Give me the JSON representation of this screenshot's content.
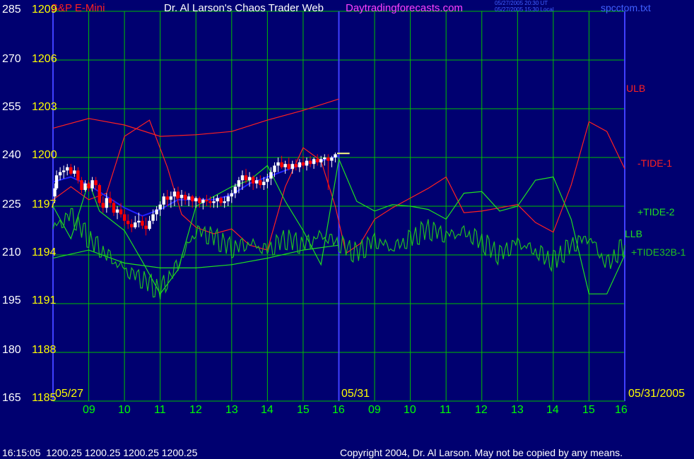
{
  "header": {
    "instrument": "S&P E-Mini",
    "title": "Dr. Al Larson's Chaos Trader Web",
    "site": "Daytradingforecasts.com",
    "time_ut": "05/27/2005 20:30 UT",
    "time_local": "05/27/2005 15:30 Local",
    "file": "spcctom.txt"
  },
  "footer": {
    "quote": "16:15:05  1200.25 1200.25 1200.25 1200.25",
    "copyright": "Copyright 2004, Dr. Al Larson. May not be copied by any means."
  },
  "colors": {
    "background": "#000070",
    "grid": "#00c000",
    "divider": "#4040ff",
    "price_up": "#ffffff",
    "price_down": "#ff0000",
    "price_flat": "#ffff80",
    "avg": "#2020ff",
    "ulb": "#ff2020",
    "tide1": "#ff2020",
    "tide2": "#20e020",
    "llb": "#20e020",
    "tide32b": "#20c020"
  },
  "chart_data": {
    "type": "line",
    "left_axis_labels": [
      "285",
      "270",
      "255",
      "240",
      "225",
      "210",
      "195",
      "180",
      "165"
    ],
    "price_axis_labels": [
      "1209",
      "1206",
      "1203",
      "1200",
      "1197",
      "1194",
      "1191",
      "1188",
      "1185"
    ],
    "ylim_price": [
      1185,
      1209
    ],
    "ylim_left": [
      165,
      285
    ],
    "xlim_hours": [
      0,
      16
    ],
    "x_tick_labels": [
      "09",
      "10",
      "11",
      "12",
      "13",
      "14",
      "15",
      "16",
      "09",
      "10",
      "11",
      "12",
      "13",
      "14",
      "15",
      "16"
    ],
    "x_tick_hours": [
      1,
      2,
      3,
      4,
      5,
      6,
      7,
      8,
      9,
      10,
      11,
      12,
      13,
      14,
      15,
      16
    ],
    "date_labels": [
      "05/27",
      "05/31",
      "05/31/2005"
    ],
    "last_price": 1200.25,
    "price_bars": [
      [
        0.05,
        1197.2,
        1198.4,
        1197.6,
        1198.1
      ],
      [
        0.1,
        1198.0,
        1199.2,
        1198.1,
        1198.9
      ],
      [
        0.2,
        1198.6,
        1199.4,
        1198.9,
        1199.1
      ],
      [
        0.3,
        1198.7,
        1199.5,
        1199.1,
        1199.2
      ],
      [
        0.4,
        1198.9,
        1199.6,
        1199.2,
        1199.4
      ],
      [
        0.5,
        1198.9,
        1199.6,
        1199.4,
        1199.0
      ],
      [
        0.6,
        1198.8,
        1199.5,
        1199.0,
        1199.2
      ],
      [
        0.7,
        1198.4,
        1199.4,
        1199.2,
        1198.6
      ],
      [
        0.8,
        1197.8,
        1198.8,
        1198.6,
        1198.0
      ],
      [
        0.9,
        1197.9,
        1198.6,
        1198.0,
        1198.4
      ],
      [
        1.0,
        1197.9,
        1198.6,
        1198.4,
        1198.1
      ],
      [
        1.1,
        1197.9,
        1198.8,
        1198.1,
        1198.6
      ],
      [
        1.2,
        1198.0,
        1198.8,
        1198.6,
        1198.3
      ],
      [
        1.3,
        1197.0,
        1198.4,
        1198.3,
        1197.2
      ],
      [
        1.4,
        1196.6,
        1197.6,
        1197.2,
        1196.9
      ],
      [
        1.5,
        1196.6,
        1197.8,
        1196.9,
        1197.5
      ],
      [
        1.6,
        1196.9,
        1197.9,
        1197.5,
        1197.2
      ],
      [
        1.7,
        1196.4,
        1197.4,
        1197.2,
        1196.6
      ],
      [
        1.8,
        1196.2,
        1197.0,
        1196.6,
        1196.8
      ],
      [
        1.9,
        1196.3,
        1197.2,
        1196.8,
        1196.5
      ],
      [
        2.0,
        1195.8,
        1196.8,
        1196.5,
        1196.1
      ],
      [
        2.1,
        1195.6,
        1196.5,
        1196.1,
        1195.9
      ],
      [
        2.2,
        1195.4,
        1196.2,
        1195.9,
        1195.7
      ],
      [
        2.3,
        1195.6,
        1196.4,
        1195.7,
        1196.0
      ],
      [
        2.4,
        1195.7,
        1196.6,
        1196.0,
        1196.1
      ],
      [
        2.5,
        1195.6,
        1196.4,
        1196.1,
        1195.8
      ],
      [
        2.6,
        1195.2,
        1196.3,
        1195.8,
        1195.6
      ],
      [
        2.7,
        1195.5,
        1196.4,
        1195.6,
        1196.1
      ],
      [
        2.8,
        1195.9,
        1196.8,
        1196.1,
        1196.5
      ],
      [
        2.9,
        1196.1,
        1197.0,
        1196.5,
        1196.8
      ],
      [
        3.0,
        1196.4,
        1197.3,
        1196.8,
        1197.1
      ],
      [
        3.1,
        1196.8,
        1197.8,
        1197.1,
        1197.6
      ],
      [
        3.2,
        1197.0,
        1198.0,
        1197.6,
        1197.4
      ],
      [
        3.3,
        1196.9,
        1197.9,
        1197.4,
        1197.6
      ],
      [
        3.4,
        1197.0,
        1198.1,
        1197.6,
        1197.9
      ],
      [
        3.5,
        1197.2,
        1198.2,
        1197.9,
        1197.5
      ],
      [
        3.6,
        1197.0,
        1198.0,
        1197.5,
        1197.7
      ],
      [
        3.7,
        1197.1,
        1197.9,
        1197.7,
        1197.4
      ],
      [
        3.8,
        1197.0,
        1197.8,
        1197.4,
        1197.6
      ],
      [
        3.9,
        1196.9,
        1197.7,
        1197.6,
        1197.3
      ],
      [
        4.0,
        1196.9,
        1197.6,
        1197.3,
        1197.5
      ],
      [
        4.1,
        1196.9,
        1197.6,
        1197.5,
        1197.2
      ],
      [
        4.2,
        1196.8,
        1197.5,
        1197.2,
        1197.4
      ],
      [
        4.3,
        1197.0,
        1197.7,
        1197.4,
        1197.3
      ],
      [
        4.4,
        1196.9,
        1197.6,
        1197.3,
        1197.2
      ],
      [
        4.5,
        1196.9,
        1197.6,
        1197.2,
        1197.3
      ],
      [
        4.6,
        1196.9,
        1197.7,
        1197.3,
        1197.5
      ],
      [
        4.7,
        1197.0,
        1197.6,
        1197.5,
        1197.2
      ],
      [
        4.8,
        1196.9,
        1197.6,
        1197.2,
        1197.3
      ],
      [
        4.9,
        1197.0,
        1197.8,
        1197.3,
        1197.6
      ],
      [
        5.0,
        1197.2,
        1198.0,
        1197.6,
        1197.8
      ],
      [
        5.1,
        1197.5,
        1198.4,
        1197.8,
        1198.2
      ],
      [
        5.2,
        1197.8,
        1198.8,
        1198.2,
        1198.6
      ],
      [
        5.3,
        1198.0,
        1199.2,
        1198.6,
        1198.9
      ],
      [
        5.4,
        1198.4,
        1199.3,
        1198.9,
        1198.6
      ],
      [
        5.5,
        1198.2,
        1199.1,
        1198.6,
        1198.8
      ],
      [
        5.6,
        1198.0,
        1198.9,
        1198.8,
        1198.4
      ],
      [
        5.7,
        1198.1,
        1198.8,
        1198.4,
        1198.6
      ],
      [
        5.8,
        1198.1,
        1198.9,
        1198.6,
        1198.3
      ],
      [
        5.9,
        1198.0,
        1198.8,
        1198.3,
        1198.5
      ],
      [
        6.0,
        1198.1,
        1199.0,
        1198.5,
        1198.7
      ],
      [
        6.1,
        1198.3,
        1199.4,
        1198.7,
        1199.1
      ],
      [
        6.2,
        1198.8,
        1199.7,
        1199.1,
        1199.5
      ],
      [
        6.3,
        1199.1,
        1200.0,
        1199.5,
        1199.7
      ],
      [
        6.4,
        1199.3,
        1200.1,
        1199.7,
        1199.4
      ],
      [
        6.5,
        1199.0,
        1199.8,
        1199.4,
        1199.6
      ],
      [
        6.6,
        1199.2,
        1200.0,
        1199.6,
        1199.3
      ],
      [
        6.7,
        1199.0,
        1199.8,
        1199.3,
        1199.6
      ],
      [
        6.8,
        1199.2,
        1199.9,
        1199.6,
        1199.4
      ],
      [
        6.9,
        1199.1,
        1199.9,
        1199.4,
        1199.7
      ],
      [
        7.0,
        1199.3,
        1200.1,
        1199.7,
        1199.5
      ],
      [
        7.1,
        1199.2,
        1200.0,
        1199.5,
        1199.8
      ],
      [
        7.2,
        1199.4,
        1200.1,
        1199.8,
        1199.6
      ],
      [
        7.3,
        1199.3,
        1200.0,
        1199.6,
        1199.9
      ],
      [
        7.4,
        1199.5,
        1200.2,
        1199.9,
        1199.7
      ],
      [
        7.5,
        1199.4,
        1200.1,
        1199.7,
        1199.9
      ],
      [
        7.6,
        1199.5,
        1200.2,
        1199.9,
        1200.0
      ],
      [
        7.7,
        1198.0,
        1200.2,
        1200.0,
        1199.8
      ],
      [
        7.8,
        1199.4,
        1200.1,
        1199.8,
        1200.0
      ],
      [
        7.9,
        1199.7,
        1200.3,
        1200.0,
        1200.2
      ]
    ],
    "last_price_tick": [
      7.95,
      8.3
    ],
    "series": [
      {
        "name": "ULB",
        "color_key": "ulb",
        "points": [
          [
            0,
            1201.8
          ],
          [
            1,
            1202.4
          ],
          [
            2,
            1202.0
          ],
          [
            3,
            1201.3
          ],
          [
            4,
            1201.4
          ],
          [
            5,
            1201.6
          ],
          [
            6,
            1202.3
          ],
          [
            7,
            1202.9
          ],
          [
            8,
            1203.6
          ]
        ]
      },
      {
        "name": "-TIDE-1",
        "color_key": "tide1",
        "points": [
          [
            0,
            1197.4
          ],
          [
            0.5,
            1198.2
          ],
          [
            1,
            1197.4
          ],
          [
            1.5,
            1197.8
          ],
          [
            2,
            1201.3
          ],
          [
            2.7,
            1202.3
          ],
          [
            3.2,
            1199.4
          ],
          [
            3.6,
            1196.5
          ],
          [
            4,
            1195.7
          ],
          [
            4.5,
            1195.3
          ],
          [
            5,
            1195.6
          ],
          [
            5.5,
            1194.6
          ],
          [
            6,
            1194.3
          ],
          [
            6.5,
            1198.2
          ],
          [
            7,
            1200.6
          ],
          [
            7.5,
            1199.8
          ],
          [
            7.9,
            1197.0
          ],
          [
            8.2,
            1194.1
          ],
          [
            8.6,
            1194.7
          ],
          [
            9,
            1196.2
          ],
          [
            9.5,
            1196.9
          ],
          [
            10,
            1197.5
          ],
          [
            10.5,
            1198.1
          ],
          [
            11,
            1198.8
          ],
          [
            11.5,
            1196.6
          ],
          [
            12,
            1196.7
          ],
          [
            12.5,
            1196.9
          ],
          [
            13,
            1197.1
          ],
          [
            13.5,
            1196.0
          ],
          [
            14,
            1195.4
          ],
          [
            14.5,
            1198.3
          ],
          [
            15,
            1202.2
          ],
          [
            15.5,
            1201.6
          ],
          [
            16,
            1199.3
          ]
        ]
      },
      {
        "name": "+TIDE-2",
        "color_key": "tide2",
        "points": [
          [
            0,
            1197.0
          ],
          [
            0.5,
            1195.0
          ],
          [
            1,
            1198.5
          ],
          [
            1.3,
            1196.7
          ],
          [
            2,
            1195.5
          ],
          [
            2.5,
            1193.6
          ],
          [
            3,
            1191.6
          ],
          [
            3.5,
            1193.1
          ],
          [
            4,
            1197.0
          ],
          [
            4.5,
            1197.6
          ],
          [
            5,
            1198.2
          ],
          [
            5.5,
            1198.6
          ],
          [
            6,
            1199.5
          ],
          [
            6.5,
            1197.3
          ],
          [
            7,
            1195.5
          ],
          [
            7.5,
            1193.4
          ],
          [
            8,
            1199.9
          ],
          [
            8.5,
            1197.3
          ],
          [
            9,
            1196.7
          ],
          [
            9.5,
            1197.1
          ],
          [
            10,
            1197.0
          ],
          [
            10.5,
            1196.8
          ],
          [
            11,
            1196.2
          ],
          [
            11.5,
            1197.8
          ],
          [
            12,
            1197.9
          ],
          [
            12.5,
            1196.7
          ],
          [
            13,
            1197.0
          ],
          [
            13.5,
            1198.6
          ],
          [
            14,
            1198.8
          ],
          [
            14.5,
            1196.2
          ],
          [
            15,
            1191.6
          ],
          [
            15.5,
            1191.6
          ],
          [
            16,
            1194.0
          ]
        ]
      },
      {
        "name": "LLB",
        "color_key": "llb",
        "points": [
          [
            0,
            1193.8
          ],
          [
            1,
            1194.3
          ],
          [
            2,
            1193.5
          ],
          [
            3,
            1193.2
          ],
          [
            4,
            1193.2
          ],
          [
            5,
            1193.4
          ],
          [
            6,
            1193.8
          ],
          [
            7,
            1194.3
          ],
          [
            8,
            1194.6
          ]
        ]
      },
      {
        "name": "+TIDE32B-1",
        "color_key": "tide32b",
        "points": [
          [
            0,
            1195.6
          ],
          [
            0.5,
            1196.5
          ],
          [
            1,
            1195.0
          ],
          [
            1.5,
            1194.0
          ],
          [
            2,
            1193.1
          ],
          [
            2.5,
            1192.5
          ],
          [
            3,
            1191.8
          ],
          [
            3.5,
            1193.4
          ],
          [
            4,
            1195.5
          ],
          [
            4.5,
            1195.1
          ],
          [
            5,
            1194.4
          ],
          [
            5.5,
            1194.7
          ],
          [
            6,
            1194.3
          ],
          [
            6.5,
            1195.0
          ],
          [
            7,
            1194.6
          ],
          [
            7.5,
            1195.2
          ],
          [
            8,
            1194.7
          ],
          [
            8.5,
            1194.1
          ],
          [
            9,
            1194.9
          ],
          [
            9.5,
            1194.4
          ],
          [
            10,
            1195.0
          ],
          [
            10.5,
            1195.6
          ],
          [
            11,
            1195.2
          ],
          [
            11.5,
            1195.4
          ],
          [
            12,
            1194.8
          ],
          [
            12.5,
            1194.0
          ],
          [
            13,
            1194.8
          ],
          [
            13.5,
            1194.2
          ],
          [
            14,
            1193.6
          ],
          [
            14.5,
            1194.6
          ],
          [
            15,
            1195.1
          ],
          [
            15.5,
            1193.4
          ],
          [
            16,
            1194.6
          ]
        ]
      },
      {
        "name": "avg",
        "color_key": "avg",
        "points": [
          [
            0,
            1198.5
          ],
          [
            0.5,
            1198.8
          ],
          [
            1,
            1198.3
          ],
          [
            1.5,
            1197.6
          ],
          [
            2,
            1196.9
          ],
          [
            2.5,
            1196.4
          ],
          [
            3,
            1196.8
          ],
          [
            3.5,
            1197.4
          ],
          [
            4,
            1197.4
          ],
          [
            4.5,
            1197.4
          ],
          [
            5,
            1197.7
          ],
          [
            5.5,
            1198.4
          ],
          [
            6,
            1198.8
          ],
          [
            6.5,
            1199.2
          ],
          [
            7,
            1199.6
          ],
          [
            7.5,
            1199.8
          ],
          [
            8,
            1200.1
          ]
        ]
      }
    ]
  }
}
